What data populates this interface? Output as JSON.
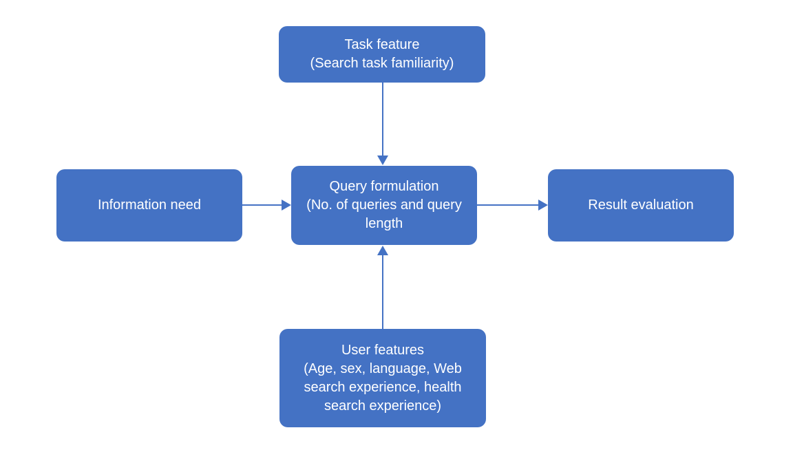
{
  "nodes": {
    "top": {
      "line1": "Task feature",
      "line2": "(Search task familiarity)"
    },
    "left": {
      "line1": "Information need"
    },
    "center": {
      "line1": "Query formulation",
      "line2": "(No. of queries and query",
      "line3": "length"
    },
    "right": {
      "line1": "Result evaluation"
    },
    "bottom": {
      "line1": "User features",
      "line2": "(Age, sex, language, Web",
      "line3": "search experience, health",
      "line4": "search experience)"
    }
  },
  "colors": {
    "node_fill": "#4472c4",
    "text": "#ffffff",
    "arrow": "#4472c4"
  }
}
